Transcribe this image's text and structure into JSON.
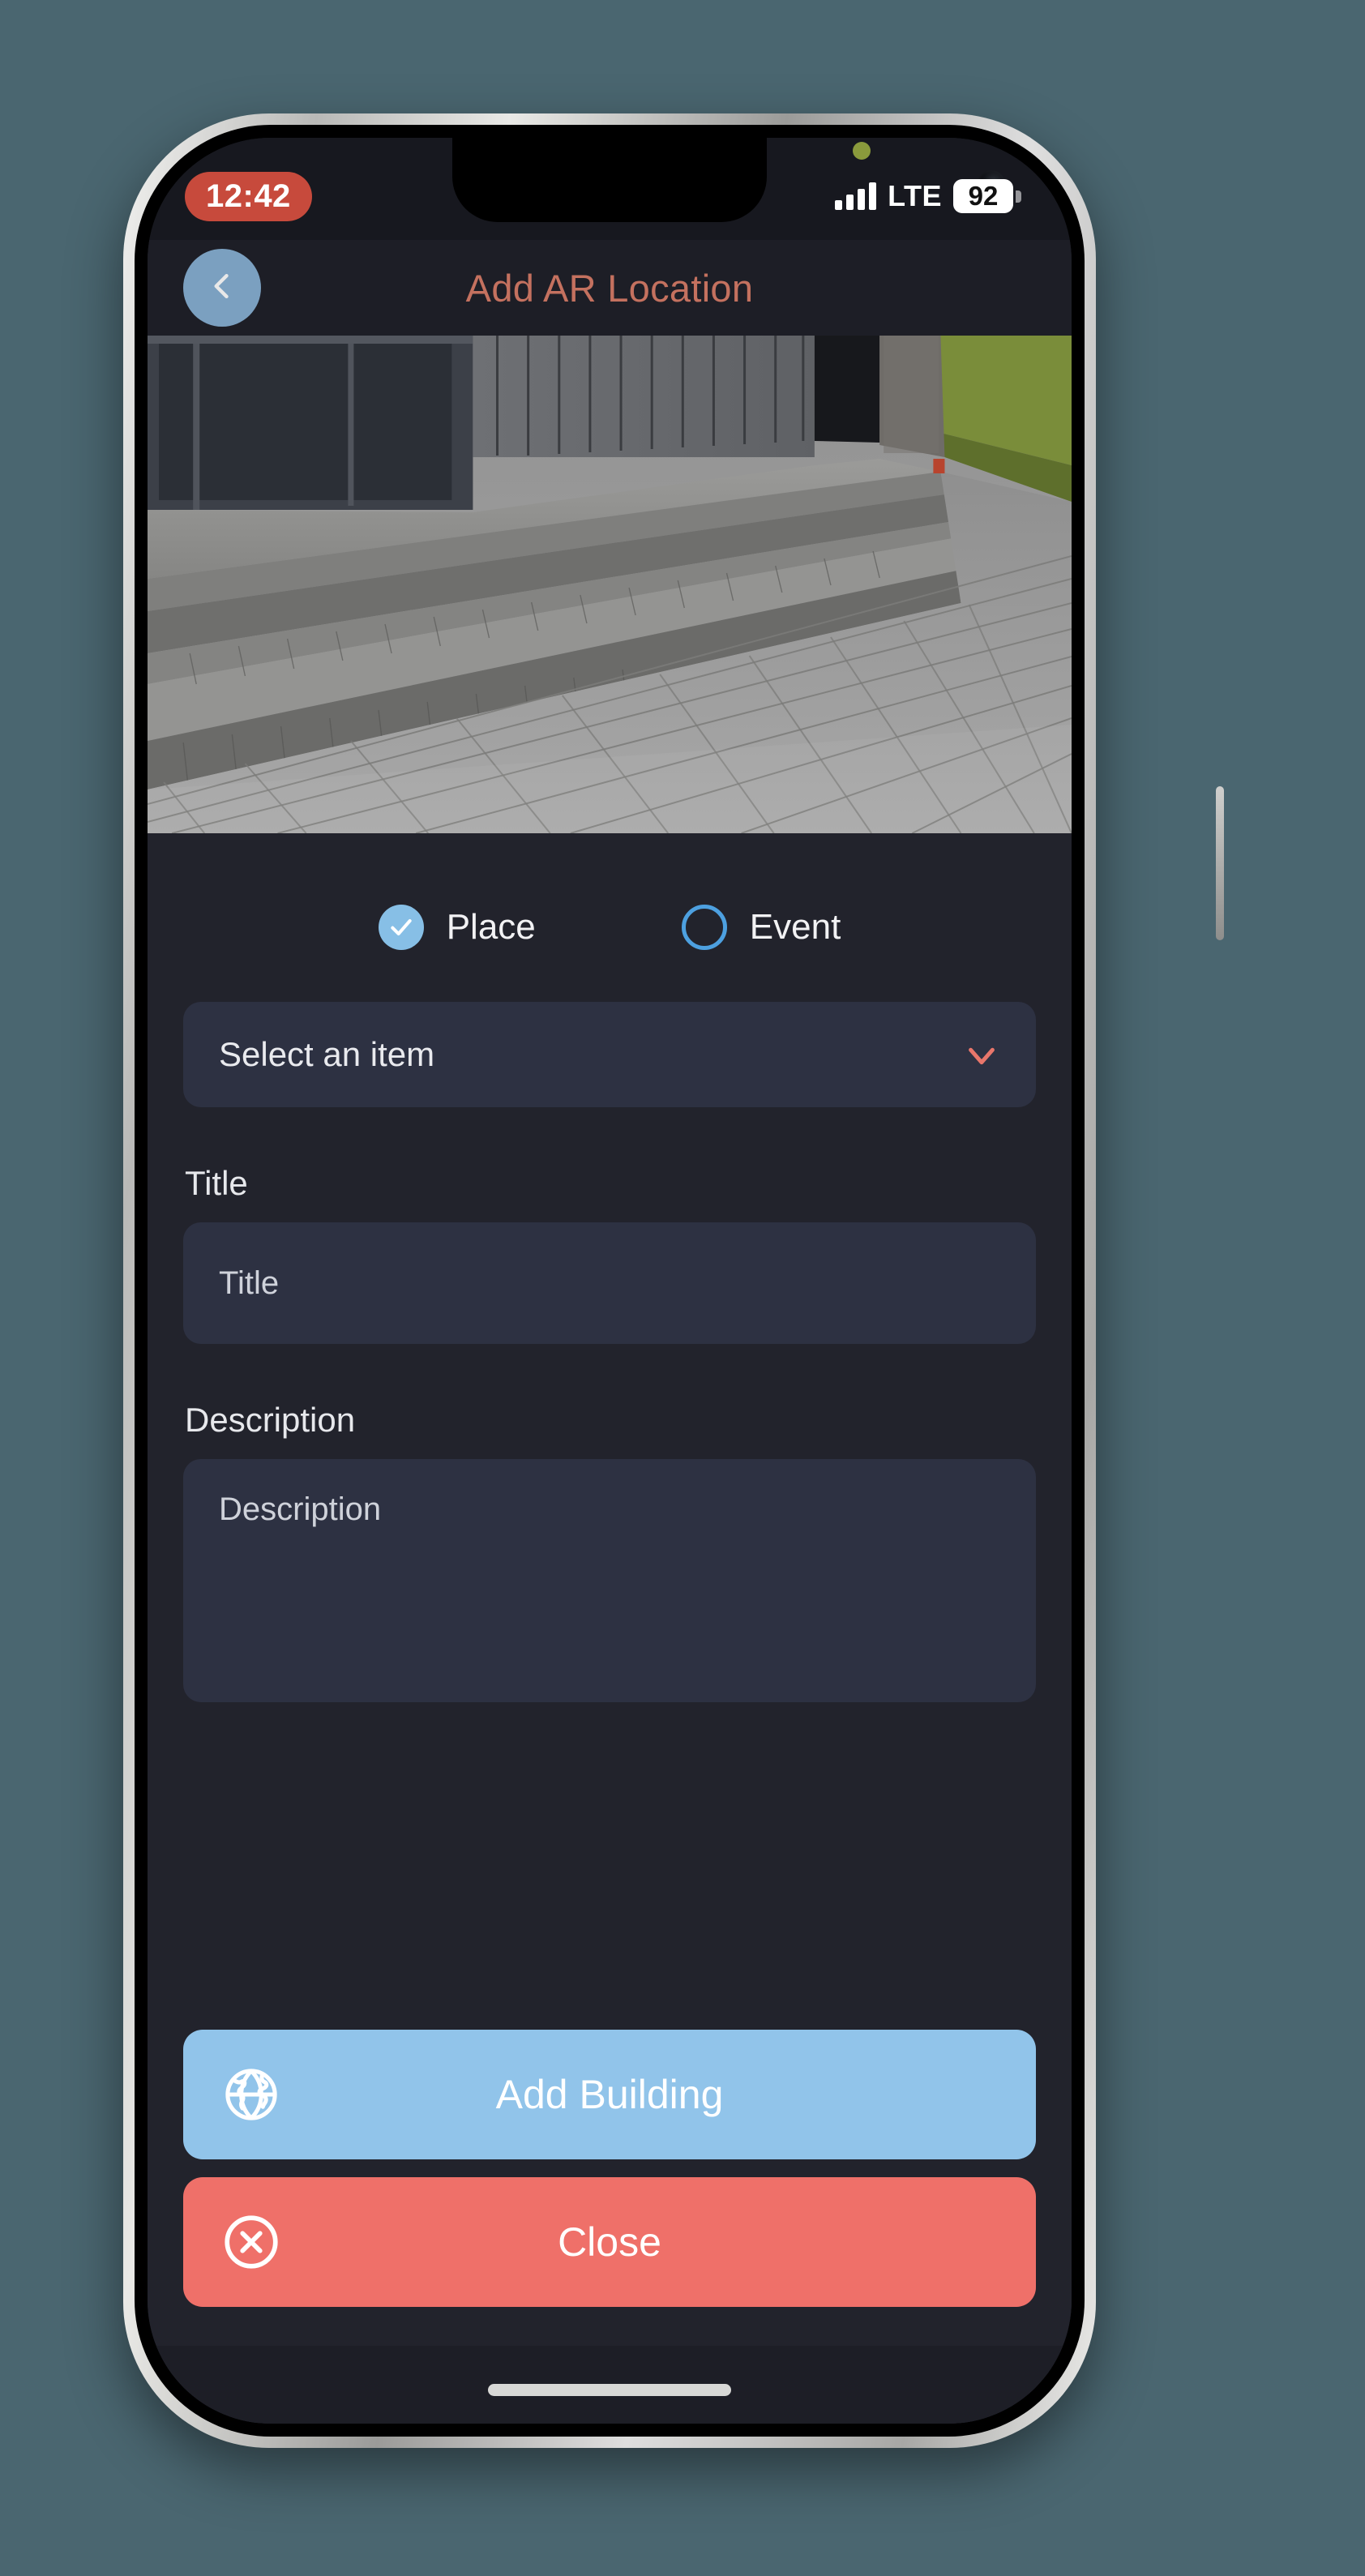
{
  "status_bar": {
    "time": "12:42",
    "carrier": "LTE",
    "battery_level": "92",
    "signal_icon": "signal-bars-icon",
    "privacy_indicator": "green-privacy-dot"
  },
  "nav": {
    "title": "Add AR Location",
    "back_icon": "chevron-left-icon"
  },
  "camera": {
    "description": "Live AR camera preview of a building entrance with concrete steps and paved walkway"
  },
  "type_selector": {
    "options": [
      {
        "label": "Place",
        "selected": true,
        "icon": "check-icon"
      },
      {
        "label": "Event",
        "selected": false,
        "icon": "circle-outline-icon"
      }
    ]
  },
  "item_select": {
    "value": "Select an item",
    "chevron_icon": "chevron-down-icon"
  },
  "title_field": {
    "label": "Title",
    "placeholder": "Title",
    "value": ""
  },
  "description_field": {
    "label": "Description",
    "placeholder": "Description",
    "value": ""
  },
  "actions": [
    {
      "label": "Add Building",
      "icon": "globe-icon",
      "color": "#91c4ea"
    },
    {
      "label": "Close",
      "icon": "close-circle-icon",
      "color": "#ef7069"
    }
  ],
  "colors": {
    "background": "#4a6670",
    "screen_bg": "#1d1e26",
    "form_bg": "#22232c",
    "field_bg": "#2d3142",
    "accent_coral": "#c4715f",
    "accent_blue": "#7ba0c0",
    "radio_blue": "#87bfe6",
    "time_pill": "#c74a3c"
  }
}
